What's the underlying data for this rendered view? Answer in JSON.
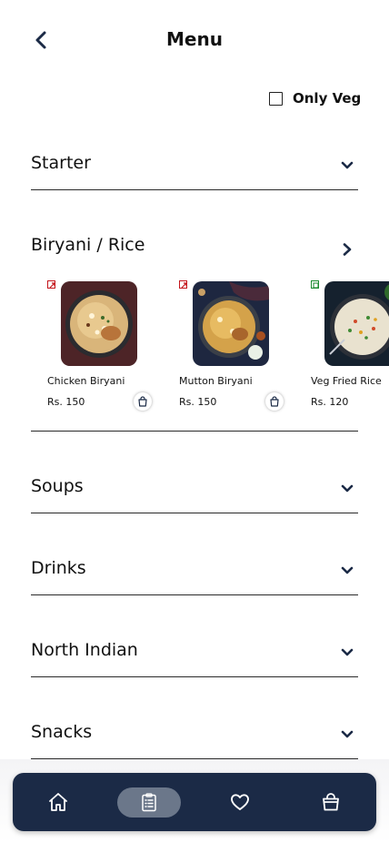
{
  "header": {
    "title": "Menu"
  },
  "filter": {
    "only_veg_label": "Only Veg",
    "only_veg_checked": false
  },
  "sections": {
    "starter": "Starter",
    "biryani": "Biryani / Rice",
    "soups": "Soups",
    "drinks": "Drinks",
    "north_indian": "North Indian",
    "snacks": "Snacks"
  },
  "biryani_items": [
    {
      "name": "Chicken Biryani",
      "price": "Rs. 150",
      "diet": "non-veg"
    },
    {
      "name": "Mutton Biryani",
      "price": "Rs. 150",
      "diet": "non-veg"
    },
    {
      "name": "Veg Fried Rice",
      "price": "Rs. 120",
      "diet": "veg"
    }
  ],
  "colors": {
    "nonveg": "#c4161c",
    "veg": "#1a8a2e",
    "tabbar": "#1b2a46",
    "accent": "#1b2a46"
  },
  "icons": {
    "back": "chevron-left-icon",
    "expand": "chevron-down-icon",
    "open": "chevron-right-icon",
    "cart": "shopping-bag-icon",
    "tabs": [
      "home-icon",
      "clipboard-list-icon",
      "heart-icon",
      "shopping-bag-icon"
    ]
  }
}
